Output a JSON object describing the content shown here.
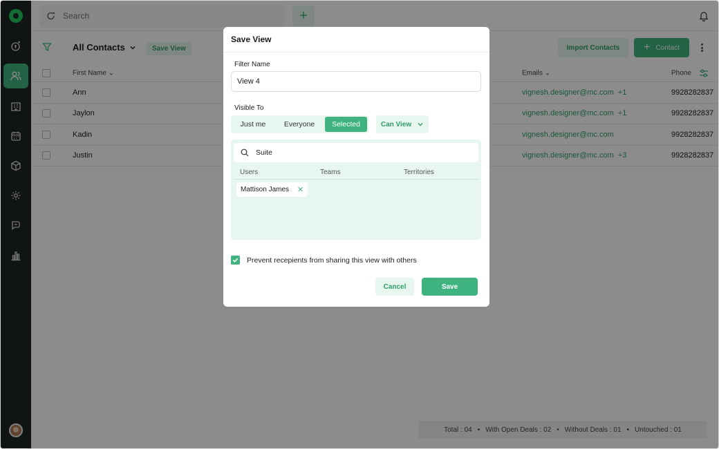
{
  "colors": {
    "accent": "#3fb37f",
    "accent_light": "#e7f6ee",
    "sidebar": "#1e2523",
    "overlay": "rgba(0,0,0,0.45)"
  },
  "sidebar": {
    "items": [
      {
        "icon": "deals-icon",
        "active": false
      },
      {
        "icon": "contacts-icon",
        "active": true
      },
      {
        "icon": "companies-icon",
        "active": false
      },
      {
        "icon": "calendar-icon",
        "active": false
      },
      {
        "icon": "products-icon",
        "active": false
      },
      {
        "icon": "settings-icon",
        "active": false
      },
      {
        "icon": "chat-icon",
        "active": false
      },
      {
        "icon": "reports-icon",
        "active": false
      }
    ]
  },
  "topbar": {
    "search_placeholder": "Search"
  },
  "header": {
    "view_title": "All Contacts",
    "save_view_label": "Save View",
    "import_label": "Import Contacts",
    "contact_label": "Contact"
  },
  "table": {
    "columns": {
      "first_name": "First Name",
      "emails": "Emails",
      "phone": "Phone"
    },
    "rows": [
      {
        "first_name": "Ann",
        "email": "vignesh.designer@mc.com",
        "more": "+1",
        "phone": "9928282837"
      },
      {
        "first_name": "Jaylon",
        "email": "vignesh.designer@mc.com",
        "more": "+1",
        "phone": "9928282837"
      },
      {
        "first_name": "Kadin",
        "email": "vignesh.designer@mc.com",
        "more": "",
        "phone": "9928282837"
      },
      {
        "first_name": "Justin",
        "email": "vignesh.designer@mc.com",
        "more": "+3",
        "phone": "9928282837"
      }
    ]
  },
  "summary": {
    "total": "Total : 04",
    "open_deals": "With Open Deals : 02",
    "without_deals": "Without Deals : 01",
    "untouched": "Untouched : 01",
    "dot": "•"
  },
  "modal": {
    "title": "Save View",
    "filter_name_label": "Filter Name",
    "filter_name_value": "View 4",
    "visible_to_label": "Visible To",
    "visibility_options": [
      "Just me",
      "Everyone",
      "Selected"
    ],
    "visibility_selected": "Selected",
    "permission": "Can View",
    "picker_search_value": "Suite",
    "picker_tabs": [
      "Users",
      "Teams",
      "Territories"
    ],
    "selected_user": "Mattison James",
    "prevent_label": "Prevent recepients from sharing this view with others",
    "prevent_checked": true,
    "cancel_label": "Cancel",
    "save_label": "Save"
  }
}
